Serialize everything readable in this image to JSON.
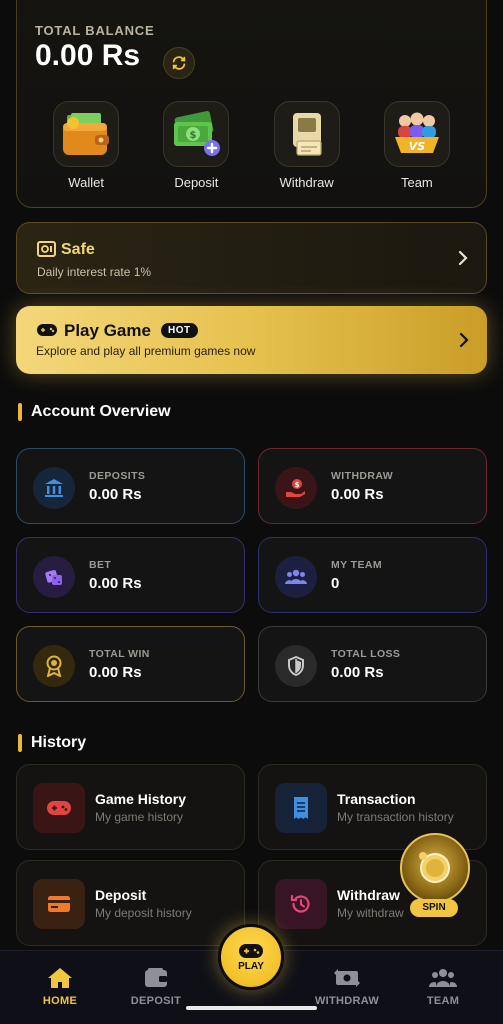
{
  "balance": {
    "label": "TOTAL BALANCE",
    "amount": "0.00 Rs"
  },
  "quick_actions": [
    {
      "label": "Wallet",
      "icon": "wallet-icon"
    },
    {
      "label": "Deposit",
      "icon": "deposit-icon"
    },
    {
      "label": "Withdraw",
      "icon": "withdraw-icon"
    },
    {
      "label": "Team",
      "icon": "team-vs-icon"
    }
  ],
  "safe": {
    "title": "Safe",
    "subtitle": "Daily interest rate 1%"
  },
  "play_game": {
    "title": "Play Game",
    "badge": "HOT",
    "subtitle": "Explore and play all premium games now"
  },
  "account_overview": {
    "title": "Account Overview",
    "stats": [
      {
        "label": "DEPOSITS",
        "value": "0.00 Rs",
        "icon": "bank-icon",
        "border": "#2b4c6b"
      },
      {
        "label": "WITHDRAW",
        "value": "0.00 Rs",
        "icon": "cash-hand-icon",
        "border": "#6b2631"
      },
      {
        "label": "BET",
        "value": "0.00 Rs",
        "icon": "dice-icon",
        "border": "#3b2d6b"
      },
      {
        "label": "MY TEAM",
        "value": "0",
        "icon": "users-icon",
        "border": "#2d2f6b"
      },
      {
        "label": "TOTAL WIN",
        "value": "0.00 Rs",
        "icon": "award-icon",
        "border": "#6b5a2a"
      },
      {
        "label": "TOTAL LOSS",
        "value": "0.00 Rs",
        "icon": "shield-icon",
        "border": "#3a3a3a"
      }
    ]
  },
  "history": {
    "title": "History",
    "items": [
      {
        "title": "Game History",
        "subtitle": "My game history",
        "icon": "gamepad-icon"
      },
      {
        "title": "Transaction",
        "subtitle": "My transaction history",
        "icon": "receipt-icon"
      },
      {
        "title": "Deposit",
        "subtitle": "My deposit history",
        "icon": "card-icon"
      },
      {
        "title": "Withdraw",
        "subtitle": "My withdraw history",
        "icon": "history-icon"
      }
    ]
  },
  "spin": {
    "label": "SPIN"
  },
  "bottom_nav": {
    "items": [
      {
        "label": "HOME",
        "icon": "home-icon"
      },
      {
        "label": "DEPOSIT",
        "icon": "wallet-icon"
      },
      {
        "label": "WITHDRAW",
        "icon": "exchange-icon"
      },
      {
        "label": "TEAM",
        "icon": "team-icon"
      }
    ],
    "play_label": "PLAY",
    "active": "HOME"
  },
  "colors": {
    "accent": "#f0c542",
    "background": "#0c0c0c"
  }
}
